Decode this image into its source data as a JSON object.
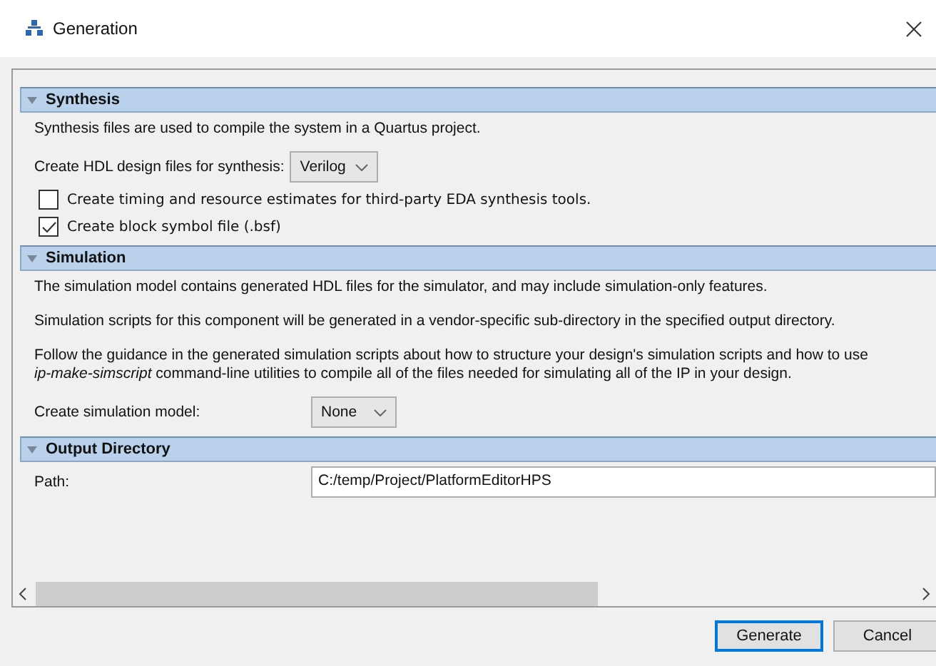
{
  "window": {
    "title": "Generation"
  },
  "sections": [
    {
      "title": "Synthesis",
      "expanded": true,
      "rows": [
        {
          "kind": "text",
          "text": "Synthesis files are used to compile the system in a Quartus project."
        },
        {
          "kind": "select",
          "label": "Create HDL design files for synthesis:",
          "value": "Verilog",
          "wide": false
        },
        {
          "kind": "checkbox",
          "label": "Create timing and resource estimates for third-party EDA synthesis tools.",
          "checked": false
        },
        {
          "kind": "checkbox",
          "label": "Create block symbol file (.bsf)",
          "checked": true
        }
      ]
    },
    {
      "title": "Simulation",
      "expanded": true,
      "rows": [
        {
          "kind": "text",
          "text": "The simulation model contains generated HDL files for the simulator, and may include simulation-only features."
        },
        {
          "kind": "text",
          "text": "Simulation scripts for this component will be generated in a vendor-specific sub-directory in the specified output directory."
        },
        {
          "kind": "text",
          "text": "Follow the guidance in the generated simulation scripts about how to structure your design's simulation scripts and how to use\n*ip-make-simscript* command-line utilities to compile all of the files needed for simulating all of the IP in your design."
        },
        {
          "kind": "select",
          "label": "Create simulation model:",
          "value": "None",
          "wide": true
        }
      ]
    },
    {
      "title": "Output Directory",
      "expanded": true,
      "rows": [
        {
          "kind": "field",
          "label": "Path:",
          "value": "C:/temp/Project/PlatformEditorHPS"
        }
      ]
    }
  ],
  "buttons": [
    {
      "label": "Generate",
      "default": true
    },
    {
      "label": "Cancel",
      "default": false
    }
  ]
}
